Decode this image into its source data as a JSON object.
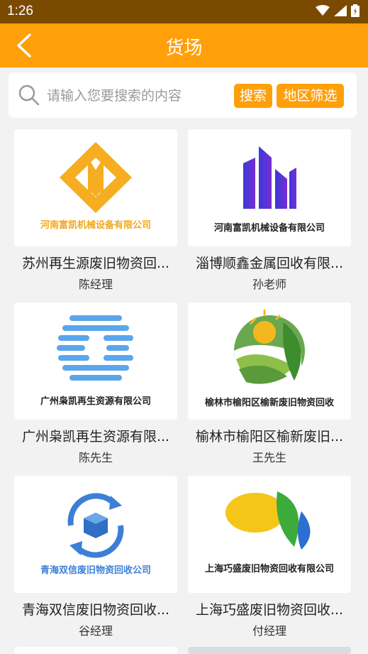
{
  "status": {
    "time": "1:26"
  },
  "header": {
    "title": "货场"
  },
  "search": {
    "placeholder": "请输入您要搜索的内容",
    "search_label": "搜索",
    "region_label": "地区筛选"
  },
  "cards": [
    {
      "logo_text": "河南富凯机械设备有限公司",
      "name": "苏州再生源废旧物资回...",
      "contact": "陈经理"
    },
    {
      "logo_text": "河南富凯机械设备有限公司",
      "name": "淄博顺鑫金属回收有限...",
      "contact": "孙老师"
    },
    {
      "logo_text": "广州枭凯再生资源有限公司",
      "name": "广州枭凯再生资源有限...",
      "contact": "陈先生"
    },
    {
      "logo_text": "榆林市榆阳区榆新废旧物资回收",
      "name": "榆林市榆阳区榆新废旧...",
      "contact": "王先生"
    },
    {
      "logo_text": "青海双信废旧物资回收公司",
      "name": "青海双信废旧物资回收...",
      "contact": "谷经理"
    },
    {
      "logo_text": "上海巧盛废旧物资回收有限公司",
      "name": "上海巧盛废旧物资回收...",
      "contact": "付经理"
    }
  ],
  "colors": {
    "accent": "#ff9f0a",
    "status_bar": "#7a4a00"
  }
}
